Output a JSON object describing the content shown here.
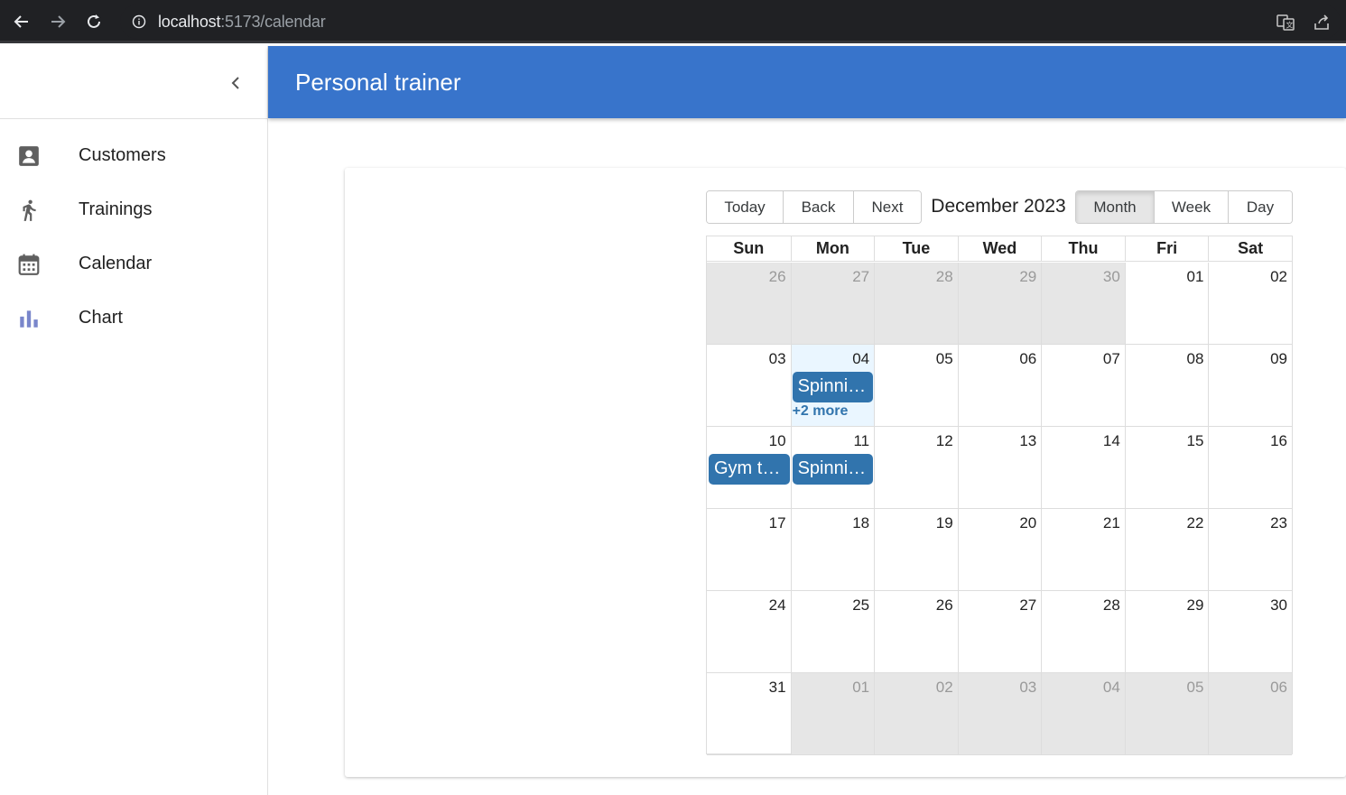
{
  "browser": {
    "url_host": "localhost",
    "url_path": ":5173/calendar"
  },
  "app": {
    "title": "Personal trainer"
  },
  "sidebar": {
    "items": [
      {
        "label": "Customers",
        "icon": "person-card-icon"
      },
      {
        "label": "Trainings",
        "icon": "runner-icon"
      },
      {
        "label": "Calendar",
        "icon": "calendar-icon"
      },
      {
        "label": "Chart",
        "icon": "bar-chart-icon"
      }
    ]
  },
  "toolbar": {
    "today": "Today",
    "back": "Back",
    "next": "Next",
    "label": "December 2023",
    "views": [
      "Month",
      "Week",
      "Day"
    ],
    "active_view": "Month"
  },
  "calendar": {
    "weekdays": [
      "Sun",
      "Mon",
      "Tue",
      "Wed",
      "Thu",
      "Fri",
      "Sat"
    ],
    "weeks": [
      [
        {
          "d": "26",
          "off": true
        },
        {
          "d": "27",
          "off": true
        },
        {
          "d": "28",
          "off": true
        },
        {
          "d": "29",
          "off": true
        },
        {
          "d": "30",
          "off": true
        },
        {
          "d": "01"
        },
        {
          "d": "02"
        }
      ],
      [
        {
          "d": "03"
        },
        {
          "d": "04",
          "today": true
        },
        {
          "d": "05"
        },
        {
          "d": "06"
        },
        {
          "d": "07"
        },
        {
          "d": "08"
        },
        {
          "d": "09"
        }
      ],
      [
        {
          "d": "10"
        },
        {
          "d": "11"
        },
        {
          "d": "12"
        },
        {
          "d": "13"
        },
        {
          "d": "14"
        },
        {
          "d": "15"
        },
        {
          "d": "16"
        }
      ],
      [
        {
          "d": "17"
        },
        {
          "d": "18"
        },
        {
          "d": "19"
        },
        {
          "d": "20"
        },
        {
          "d": "21"
        },
        {
          "d": "22"
        },
        {
          "d": "23"
        }
      ],
      [
        {
          "d": "24"
        },
        {
          "d": "25"
        },
        {
          "d": "26"
        },
        {
          "d": "27"
        },
        {
          "d": "28"
        },
        {
          "d": "29"
        },
        {
          "d": "30"
        }
      ],
      [
        {
          "d": "31"
        },
        {
          "d": "01",
          "off": true
        },
        {
          "d": "02",
          "off": true
        },
        {
          "d": "03",
          "off": true
        },
        {
          "d": "04",
          "off": true
        },
        {
          "d": "05",
          "off": true
        },
        {
          "d": "06",
          "off": true
        }
      ]
    ],
    "events": [
      {
        "title": "Spinning",
        "week": 1,
        "day": 1
      },
      {
        "title": "Gym training",
        "week": 2,
        "day": 0
      },
      {
        "title": "Spinning",
        "week": 2,
        "day": 1
      }
    ],
    "more_links": [
      {
        "label": "+2 more",
        "week": 1,
        "day": 1
      }
    ]
  },
  "colors": {
    "appbar": "#3874cb",
    "event": "#3174ad",
    "today_bg": "#eaf6ff",
    "offrange_bg": "#e6e6e6",
    "chart_icon": "#7986cb"
  }
}
